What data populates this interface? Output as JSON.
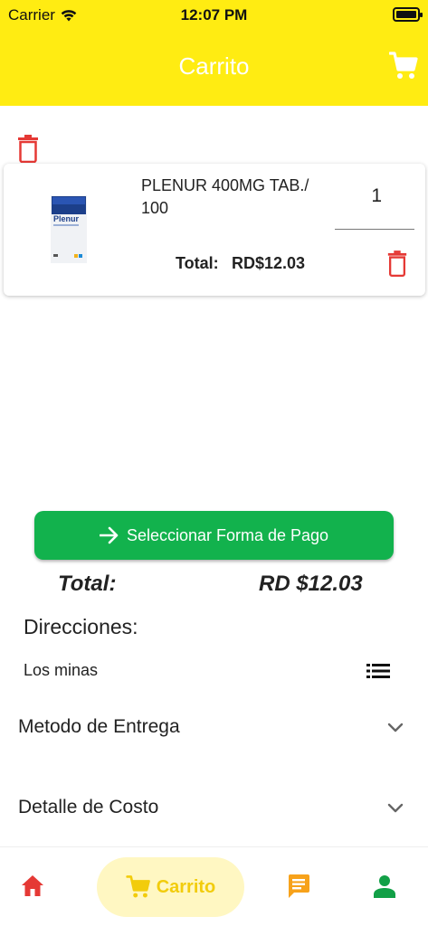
{
  "status": {
    "carrier": "Carrier",
    "time": "12:07 PM"
  },
  "header": {
    "title": "Carrito",
    "cart_icon": "cart-icon"
  },
  "cart": {
    "items": [
      {
        "name": "PLENUR 400MG TAB./ 100",
        "quantity": "1",
        "total_label": "Total:",
        "total_value": "RD$12.03"
      }
    ]
  },
  "actions": {
    "pay_label": "Seleccionar Forma de Pago"
  },
  "summary": {
    "total_label": "Total:",
    "total_value": "RD  $12.03"
  },
  "address": {
    "label": "Direcciones:",
    "value": "Los minas"
  },
  "sections": {
    "delivery_label": "Metodo de Entrega",
    "cost_label": "Detalle de Costo"
  },
  "tabbar": {
    "cart_label": "Carrito"
  },
  "colors": {
    "header": "#ffec12",
    "primary_button": "#12b24d",
    "delete": "#e53935",
    "home": "#e53935",
    "cart_active": "#f2cc0c",
    "messages": "#f7a21b",
    "profile": "#12a047"
  }
}
